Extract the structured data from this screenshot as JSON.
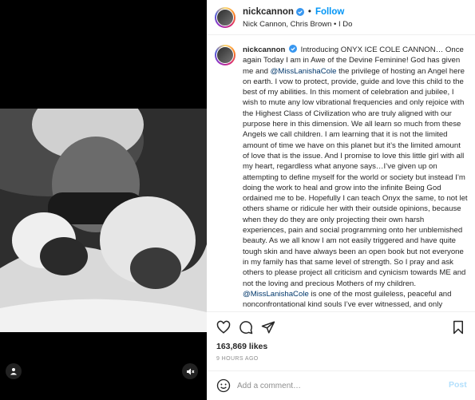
{
  "header": {
    "username": "nickcannon",
    "follow_label": "Follow",
    "subtitle": "Nick Cannon, Chris Brown • I Do"
  },
  "caption": {
    "username": "nickcannon",
    "part1": "Introducing ONYX ICE COLE CANNON… Once again Today I am in Awe of the Devine Feminine! God has given me and ",
    "mention1": "@MissLanishaCole",
    "part2": " the privilege of hosting an Angel here on earth. I vow to protect, provide, guide and love this child to the best of my abilities. In this moment of celebration and jubilee, I wish to mute any low vibrational frequencies and only rejoice with the Highest Class of Civilization who are truly aligned with our purpose here in this dimension. We all learn so much from these Angels we call children. I am learning that it is not the limited amount of time we have on this planet but it’s the limited amount of love that is the issue. And I promise to love this little girl with all my heart, regardless what anyone says…I’ve given up on attempting to define myself for the world or society but instead I’m doing the work to heal and grow into the infinite Being God ordained me to be. Hopefully I can teach Onyx the same, to not let others shame or ridicule her with their outside opinions, because when they do they are only projecting their own harsh experiences, pain and social programming onto her unblemished beauty. As we all know I am not easily triggered and have quite tough skin and have always been an open book but not everyone in my family has that same level of strength. So I pray and ask others to please project all criticism and cynicism towards ME and not the loving and precious Mothers of my children. ",
    "mention2": "@MissLanishaCole",
    "part3": " is one of the most guileless, peaceful and nonconfrontational kind souls I’ve ever witnessed, and only deserves to revel in this moment of"
  },
  "likes": "163,869 likes",
  "timestamp": "9 HOURS AGO",
  "comment": {
    "placeholder": "Add a comment…",
    "post_label": "Post"
  },
  "icons": {
    "like": "heart-icon",
    "comment": "comment-icon",
    "share": "share-icon",
    "save": "bookmark-icon",
    "emoji": "emoji-icon",
    "tagged": "person-icon",
    "audio": "mute-icon"
  },
  "colors": {
    "accent": "#0095f6",
    "verified": "#3897f0",
    "mention": "#00376b",
    "post_disabled": "#b2dffc"
  }
}
